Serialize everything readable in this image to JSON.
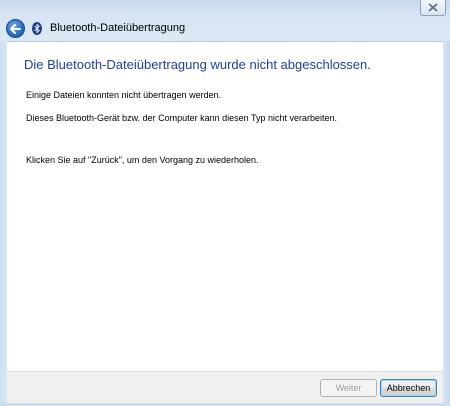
{
  "window": {
    "title": "Bluetooth-Dateiübertragung",
    "close_icon": "close-icon",
    "back_icon": "back-arrow-icon",
    "app_icon": "bluetooth-icon"
  },
  "content": {
    "heading": "Die Bluetooth-Dateiübertragung wurde nicht abgeschlossen.",
    "message1": "Einige Dateien konnten nicht übertragen werden.",
    "message2": "Dieses Bluetooth-Gerät bzw. der Computer kann diesen Typ nicht verarbeiten.",
    "message3": "Klicken Sie auf \"Zurück\", um den Vorgang zu wiederholen."
  },
  "footer": {
    "next_label": "Weiter",
    "next_enabled": false,
    "cancel_label": "Abbrechen"
  },
  "colors": {
    "heading": "#1e3f9e",
    "frame": "#d4e2f2"
  }
}
